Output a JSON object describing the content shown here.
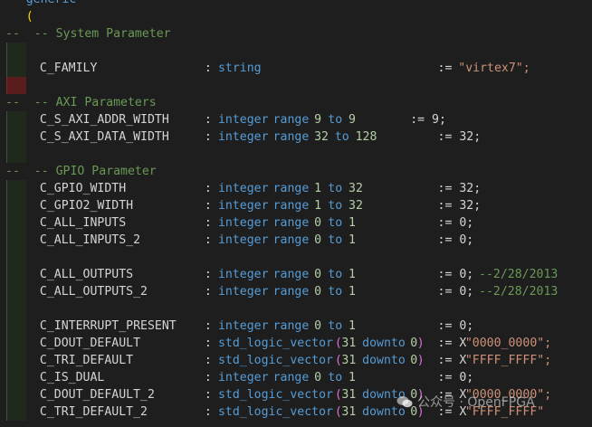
{
  "editor": {
    "lines": [
      {
        "tokens": [
          {
            "t": "generic",
            "c": "kw",
            "col": 3
          }
        ],
        "guide": false
      },
      {
        "tokens": [
          {
            "t": "(",
            "c": "paren2",
            "col": 3
          }
        ],
        "guide": false
      },
      {
        "tokens": [
          {
            "t": "--  -- System Parameter",
            "c": "comment",
            "col": 0
          }
        ],
        "guide": false
      },
      {
        "tokens": [],
        "guide": true
      },
      {
        "tokens": [
          {
            "t": "C_FAMILY",
            "c": "id",
            "col": 5
          },
          {
            "t": ":",
            "c": "id",
            "col": 29
          },
          {
            "t": "string",
            "c": "kw",
            "col": 31
          },
          {
            "t": ":=",
            "c": "id",
            "col": 63
          },
          {
            "t": "\"virtex7\";",
            "c": "str",
            "col": 66
          }
        ],
        "guide": true
      },
      {
        "tokens": [],
        "guide": true,
        "err": true
      },
      {
        "tokens": [
          {
            "t": "--  -- AXI Parameters",
            "c": "comment",
            "col": 0
          }
        ],
        "guide": false
      },
      {
        "tokens": [
          {
            "t": "C_S_AXI_ADDR_WIDTH",
            "c": "id",
            "col": 5
          },
          {
            "t": ":",
            "c": "id",
            "col": 29
          },
          {
            "t": "integer",
            "c": "kw",
            "col": 31
          },
          {
            "t": "range",
            "c": "kw",
            "col": 39
          },
          {
            "t": "9",
            "c": "num",
            "col": 45
          },
          {
            "t": "to",
            "c": "kw",
            "col": 47
          },
          {
            "t": "9",
            "c": "num",
            "col": 50
          },
          {
            "t": ":= 9;",
            "c": "id",
            "col": 59
          }
        ],
        "guide": true
      },
      {
        "tokens": [
          {
            "t": "C_S_AXI_DATA_WIDTH",
            "c": "id",
            "col": 5
          },
          {
            "t": ":",
            "c": "id",
            "col": 29
          },
          {
            "t": "integer",
            "c": "kw",
            "col": 31
          },
          {
            "t": "range",
            "c": "kw",
            "col": 39
          },
          {
            "t": "32",
            "c": "num",
            "col": 45
          },
          {
            "t": "to",
            "c": "kw",
            "col": 48
          },
          {
            "t": "128",
            "c": "num",
            "col": 51
          },
          {
            "t": ":= 32;",
            "c": "id",
            "col": 63
          }
        ],
        "guide": true
      },
      {
        "tokens": [],
        "guide": true
      },
      {
        "tokens": [
          {
            "t": "--  -- GPIO Parameter",
            "c": "comment",
            "col": 0
          }
        ],
        "guide": false
      },
      {
        "tokens": [
          {
            "t": "C_GPIO_WIDTH",
            "c": "id",
            "col": 5
          },
          {
            "t": ":",
            "c": "id",
            "col": 29
          },
          {
            "t": "integer",
            "c": "kw",
            "col": 31
          },
          {
            "t": "range",
            "c": "kw",
            "col": 39
          },
          {
            "t": "1",
            "c": "num",
            "col": 45
          },
          {
            "t": "to",
            "c": "kw",
            "col": 47
          },
          {
            "t": "32",
            "c": "num",
            "col": 50
          },
          {
            "t": ":= 32;",
            "c": "id",
            "col": 63
          }
        ],
        "guide": true
      },
      {
        "tokens": [
          {
            "t": "C_GPIO2_WIDTH",
            "c": "id",
            "col": 5
          },
          {
            "t": ":",
            "c": "id",
            "col": 29
          },
          {
            "t": "integer",
            "c": "kw",
            "col": 31
          },
          {
            "t": "range",
            "c": "kw",
            "col": 39
          },
          {
            "t": "1",
            "c": "num",
            "col": 45
          },
          {
            "t": "to",
            "c": "kw",
            "col": 47
          },
          {
            "t": "32",
            "c": "num",
            "col": 50
          },
          {
            "t": ":= 32;",
            "c": "id",
            "col": 63
          }
        ],
        "guide": true
      },
      {
        "tokens": [
          {
            "t": "C_ALL_INPUTS",
            "c": "id",
            "col": 5
          },
          {
            "t": ":",
            "c": "id",
            "col": 29
          },
          {
            "t": "integer",
            "c": "kw",
            "col": 31
          },
          {
            "t": "range",
            "c": "kw",
            "col": 39
          },
          {
            "t": "0",
            "c": "num",
            "col": 45
          },
          {
            "t": "to",
            "c": "kw",
            "col": 47
          },
          {
            "t": "1",
            "c": "num",
            "col": 50
          },
          {
            "t": ":= 0;",
            "c": "id",
            "col": 63
          }
        ],
        "guide": true
      },
      {
        "tokens": [
          {
            "t": "C_ALL_INPUTS_2",
            "c": "id",
            "col": 5
          },
          {
            "t": ":",
            "c": "id",
            "col": 29
          },
          {
            "t": "integer",
            "c": "kw",
            "col": 31
          },
          {
            "t": "range",
            "c": "kw",
            "col": 39
          },
          {
            "t": "0",
            "c": "num",
            "col": 45
          },
          {
            "t": "to",
            "c": "kw",
            "col": 47
          },
          {
            "t": "1",
            "c": "num",
            "col": 50
          },
          {
            "t": ":= 0;",
            "c": "id",
            "col": 63
          }
        ],
        "guide": true
      },
      {
        "tokens": [],
        "guide": true
      },
      {
        "tokens": [
          {
            "t": "C_ALL_OUTPUTS",
            "c": "id",
            "col": 5
          },
          {
            "t": ":",
            "c": "id",
            "col": 29
          },
          {
            "t": "integer",
            "c": "kw",
            "col": 31
          },
          {
            "t": "range",
            "c": "kw",
            "col": 39
          },
          {
            "t": "0",
            "c": "num",
            "col": 45
          },
          {
            "t": "to",
            "c": "kw",
            "col": 47
          },
          {
            "t": "1",
            "c": "num",
            "col": 50
          },
          {
            "t": ":= 0;",
            "c": "id",
            "col": 63
          },
          {
            "t": "--2/28/2013",
            "c": "comment",
            "col": 69
          }
        ],
        "guide": true
      },
      {
        "tokens": [
          {
            "t": "C_ALL_OUTPUTS_2",
            "c": "id",
            "col": 5
          },
          {
            "t": ":",
            "c": "id",
            "col": 29
          },
          {
            "t": "integer",
            "c": "kw",
            "col": 31
          },
          {
            "t": "range",
            "c": "kw",
            "col": 39
          },
          {
            "t": "0",
            "c": "num",
            "col": 45
          },
          {
            "t": "to",
            "c": "kw",
            "col": 47
          },
          {
            "t": "1",
            "c": "num",
            "col": 50
          },
          {
            "t": ":= 0;",
            "c": "id",
            "col": 63
          },
          {
            "t": "--2/28/2013",
            "c": "comment",
            "col": 69
          }
        ],
        "guide": true
      },
      {
        "tokens": [],
        "guide": true
      },
      {
        "tokens": [
          {
            "t": "C_INTERRUPT_PRESENT",
            "c": "id",
            "col": 5
          },
          {
            "t": ":",
            "c": "id",
            "col": 29
          },
          {
            "t": "integer",
            "c": "kw",
            "col": 31
          },
          {
            "t": "range",
            "c": "kw",
            "col": 39
          },
          {
            "t": "0",
            "c": "num",
            "col": 45
          },
          {
            "t": "to",
            "c": "kw",
            "col": 47
          },
          {
            "t": "1",
            "c": "num",
            "col": 50
          },
          {
            "t": ":= 0;",
            "c": "id",
            "col": 63
          }
        ],
        "guide": true
      },
      {
        "tokens": [
          {
            "t": "C_DOUT_DEFAULT",
            "c": "id",
            "col": 5
          },
          {
            "t": ":",
            "c": "id",
            "col": 29
          },
          {
            "t": "std_logic_vector",
            "c": "kw",
            "col": 31
          },
          {
            "t": "(",
            "c": "paren",
            "col": 48
          },
          {
            "t": "31",
            "c": "num",
            "col": 49
          },
          {
            "t": "downto",
            "c": "kw",
            "col": 52
          },
          {
            "t": "0",
            "c": "num",
            "col": 59
          },
          {
            "t": ")",
            "c": "paren",
            "col": 60
          },
          {
            "t": ":= X",
            "c": "id",
            "col": 63
          },
          {
            "t": "\"0000_0000\";",
            "c": "str",
            "col": 67
          }
        ],
        "guide": true
      },
      {
        "tokens": [
          {
            "t": "C_TRI_DEFAULT",
            "c": "id",
            "col": 5
          },
          {
            "t": ":",
            "c": "id",
            "col": 29
          },
          {
            "t": "std_logic_vector",
            "c": "kw",
            "col": 31
          },
          {
            "t": "(",
            "c": "paren",
            "col": 48
          },
          {
            "t": "31",
            "c": "num",
            "col": 49
          },
          {
            "t": "downto",
            "c": "kw",
            "col": 52
          },
          {
            "t": "0",
            "c": "num",
            "col": 59
          },
          {
            "t": ")",
            "c": "paren",
            "col": 60
          },
          {
            "t": ":= X",
            "c": "id",
            "col": 63
          },
          {
            "t": "\"FFFF_FFFF\";",
            "c": "str",
            "col": 67
          }
        ],
        "guide": true
      },
      {
        "tokens": [
          {
            "t": "C_IS_DUAL",
            "c": "id",
            "col": 5
          },
          {
            "t": ":",
            "c": "id",
            "col": 29
          },
          {
            "t": "integer",
            "c": "kw",
            "col": 31
          },
          {
            "t": "range",
            "c": "kw",
            "col": 39
          },
          {
            "t": "0",
            "c": "num",
            "col": 45
          },
          {
            "t": "to",
            "c": "kw",
            "col": 47
          },
          {
            "t": "1",
            "c": "num",
            "col": 50
          },
          {
            "t": ":= 0;",
            "c": "id",
            "col": 63
          }
        ],
        "guide": true
      },
      {
        "tokens": [
          {
            "t": "C_DOUT_DEFAULT_2",
            "c": "id",
            "col": 5
          },
          {
            "t": ":",
            "c": "id",
            "col": 29
          },
          {
            "t": "std_logic_vector",
            "c": "kw",
            "col": 31
          },
          {
            "t": "(",
            "c": "paren",
            "col": 48
          },
          {
            "t": "31",
            "c": "num",
            "col": 49
          },
          {
            "t": "downto",
            "c": "kw",
            "col": 52
          },
          {
            "t": "0",
            "c": "num",
            "col": 59
          },
          {
            "t": ")",
            "c": "paren",
            "col": 60
          },
          {
            "t": ":= X",
            "c": "id",
            "col": 63
          },
          {
            "t": "\"0000_0000\";",
            "c": "str",
            "col": 67
          }
        ],
        "guide": true
      },
      {
        "tokens": [
          {
            "t": "C_TRI_DEFAULT_2",
            "c": "id",
            "col": 5
          },
          {
            "t": ":",
            "c": "id",
            "col": 29
          },
          {
            "t": "std_logic_vector",
            "c": "kw",
            "col": 31
          },
          {
            "t": "(",
            "c": "paren",
            "col": 48
          },
          {
            "t": "31",
            "c": "num",
            "col": 49
          },
          {
            "t": "downto",
            "c": "kw",
            "col": 52
          },
          {
            "t": "0",
            "c": "num",
            "col": 59
          },
          {
            "t": ")",
            "c": "paren",
            "col": 60
          },
          {
            "t": ":= X",
            "c": "id",
            "col": 63
          },
          {
            "t": "\"FFFF_FFFF\"",
            "c": "str",
            "col": 67
          }
        ],
        "guide": true
      }
    ]
  },
  "watermark": {
    "text": "公众号 · OpenFPGA",
    "icon": "wechat-icon"
  },
  "colors": {
    "background": "#1e1e1e",
    "keyword": "#569cd6",
    "comment": "#6a9955",
    "string": "#ce9178",
    "number": "#b5cea8",
    "paren": "#da70d6",
    "identifier": "#d4d4d4"
  }
}
